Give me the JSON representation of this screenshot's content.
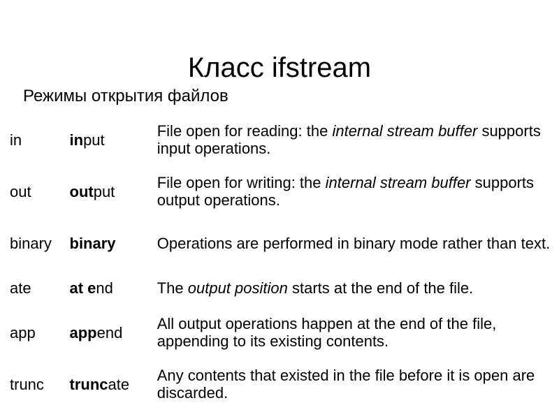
{
  "slide": {
    "title": "Класс ifstream",
    "subtitle": "Режимы открытия файлов"
  },
  "table": {
    "rows": [
      {
        "id": "in",
        "short": "in",
        "full_bold": "in",
        "full_rest": "put",
        "desc_part1": "File open for reading: the ",
        "desc_italic": "internal stream buffer",
        "desc_part2": " supports input operations."
      },
      {
        "id": "out",
        "short": "out",
        "full_bold": "out",
        "full_rest": "put",
        "desc_part1": "File open for writing: the ",
        "desc_italic": "internal stream buffer",
        "desc_part2": " supports output operations."
      },
      {
        "id": "binary",
        "short": "binary",
        "full_bold": "binary",
        "full_rest": "",
        "desc_part1": "Operations are performed in binary mode rather than text.",
        "desc_italic": "",
        "desc_part2": ""
      },
      {
        "id": "ate",
        "short": "ate",
        "full_bold": "at e",
        "full_rest": "nd",
        "desc_part1": "The ",
        "desc_italic": "output position",
        "desc_part2": " starts at the end of the file."
      },
      {
        "id": "app",
        "short": "app",
        "full_bold": "app",
        "full_rest": "end",
        "desc_part1": "All output operations happen at the end of the file, appending to its existing contents.",
        "desc_italic": "",
        "desc_part2": ""
      },
      {
        "id": "trunc",
        "short": "trunc",
        "full_bold": "trunc",
        "full_rest": "ate",
        "desc_part1": "Any contents that existed in the file before it is open are discarded.",
        "desc_italic": "",
        "desc_part2": ""
      }
    ]
  },
  "colors": {
    "background": "#ffffff",
    "text": "#000000"
  }
}
